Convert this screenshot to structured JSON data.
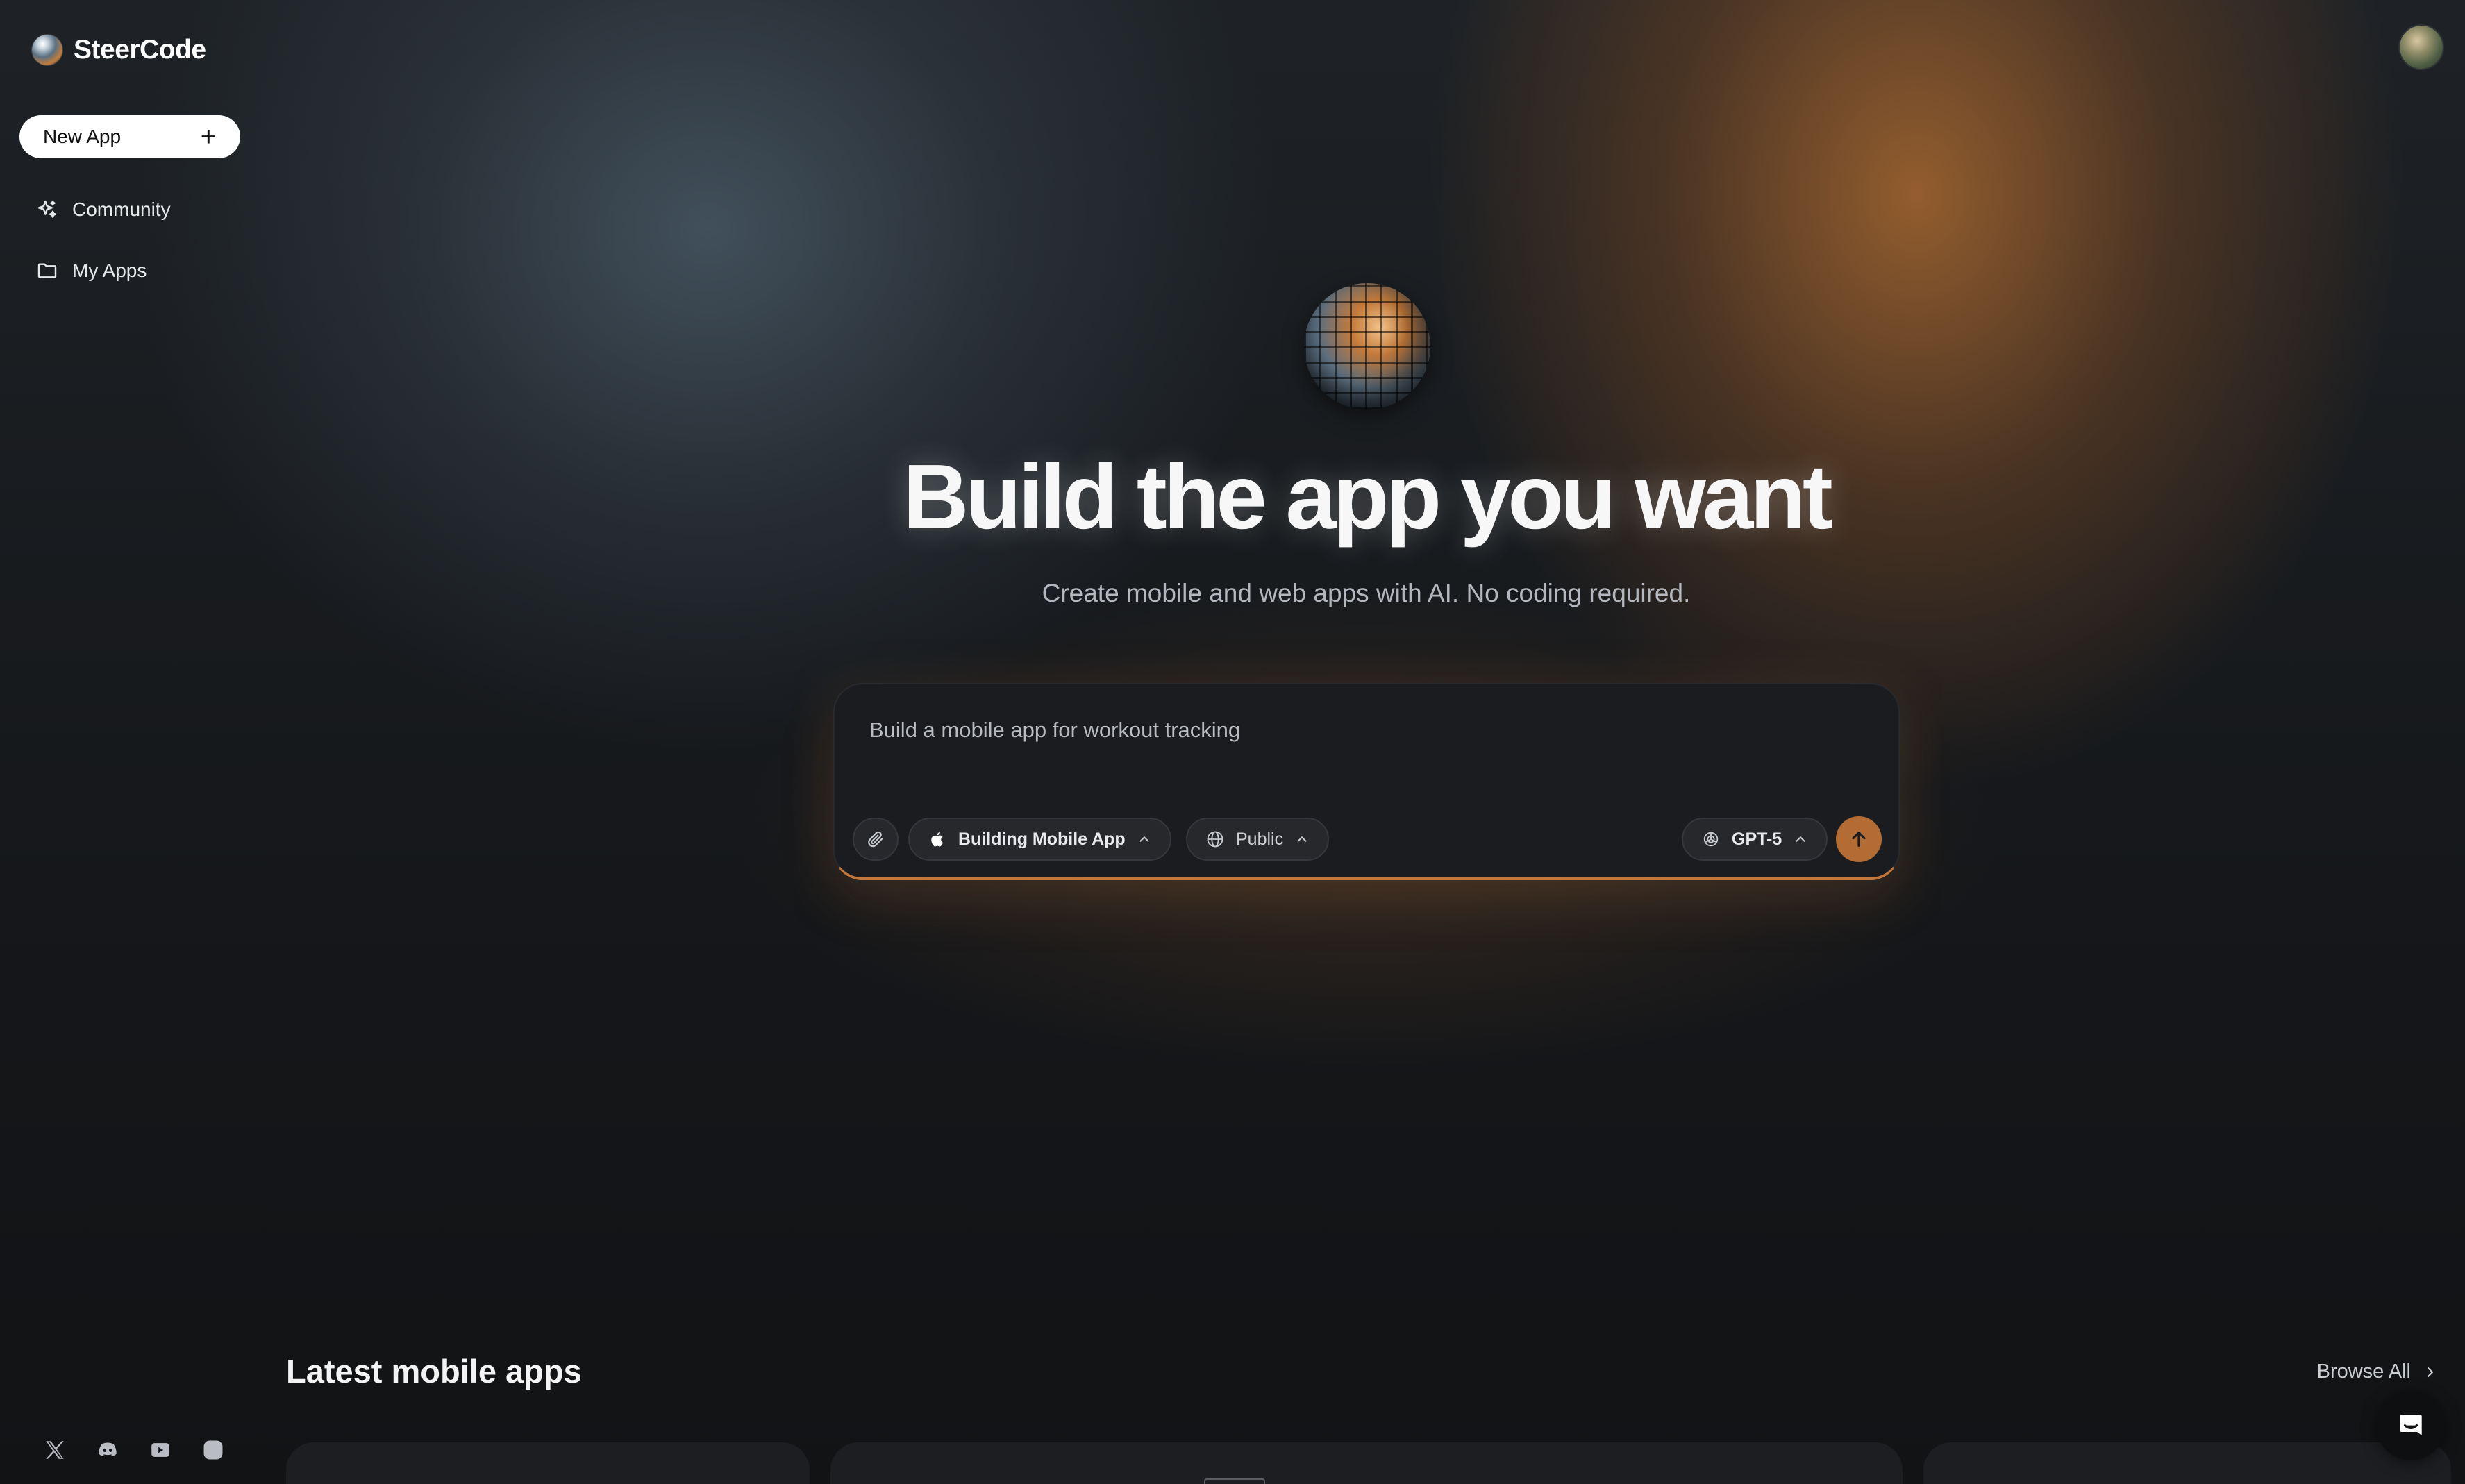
{
  "brand": {
    "name": "SteerCode"
  },
  "sidebar": {
    "new_app_label": "New App",
    "items": [
      {
        "label": "Community",
        "icon": "sparkle-icon"
      },
      {
        "label": "My Apps",
        "icon": "folder-icon"
      }
    ],
    "socials": [
      "x-icon",
      "discord-icon",
      "youtube-icon",
      "instagram-icon"
    ]
  },
  "hero": {
    "title": "Build the app you want",
    "subtitle": "Create mobile and web apps with AI. No coding required."
  },
  "prompt": {
    "placeholder": "Build a mobile app for workout tracking",
    "mode_label": "Building Mobile App",
    "visibility_label": "Public",
    "model_label": "GPT-5"
  },
  "latest": {
    "title": "Latest mobile apps",
    "browse_label": "Browse All"
  },
  "colors": {
    "accent": "#b26c34",
    "background": "#121315",
    "surface": "#1b1c1f"
  }
}
